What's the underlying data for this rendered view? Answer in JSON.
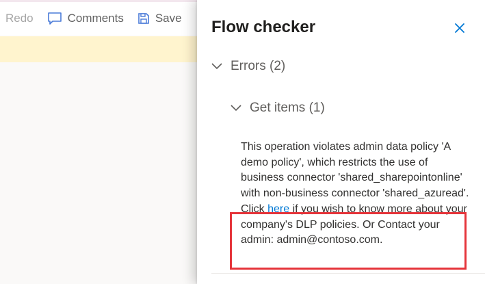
{
  "toolbar": {
    "redo_label": "Redo",
    "comments_label": "Comments",
    "save_label": "Save"
  },
  "panel": {
    "title": "Flow checker",
    "errors_label": "Errors (2)",
    "get_items_label": "Get items (1)",
    "message": {
      "part1": "This operation violates admin data policy 'A demo policy', which restricts the use of business connector 'shared_sharepointonline' with non-business connector 'shared_azuread'.",
      "click": "Click",
      "link": "here",
      "part2": "if you wish to know more about your company's DLP policies. Or Contact your admin: admin@contoso.com."
    }
  },
  "icons": {
    "comments": "speech-bubble-icon",
    "save": "floppy-disk-icon",
    "close": "close-icon",
    "chevron": "chevron-down-icon"
  },
  "colors": {
    "link": "#0078d4",
    "highlight": "#e5343a",
    "banner": "#fff4ce"
  }
}
